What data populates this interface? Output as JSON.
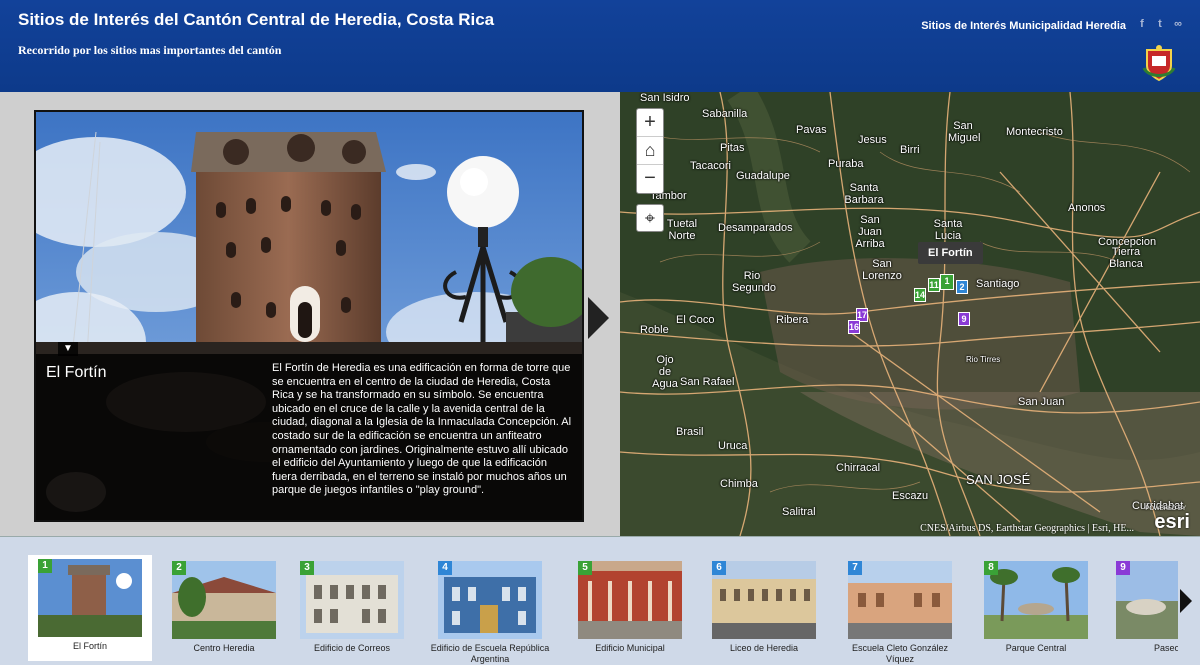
{
  "header": {
    "title": "Sitios de Interés del Cantón Central de Heredia, Costa Rica",
    "subtitle": "Recorrido por los sitios mas importantes del cantón",
    "link": "Sitios de Interés Municipalidad Heredia",
    "social_icons": [
      "facebook-icon",
      "twitter-icon",
      "link-icon"
    ]
  },
  "feature": {
    "title": "El Fortín",
    "description": "El Fortín de Heredia es una edificación en forma de torre que se encuentra en el centro de la ciudad de Heredia, Costa Rica y se ha transformado en su símbolo. Se encuentra ubicado en el cruce de la calle y la avenida central de la ciudad, diagonal a la Iglesia de la Inmaculada Concepción. Al costado sur de la edificación se encuentra un anfiteatro ornamentado con jardines. Originalmente estuvo allí ubicado el edificio del Ayuntamiento y luego de que la edificación fuera derribada, en el terreno se instaló por muchos años un parque de juegos infantiles o \"play ground\"."
  },
  "map": {
    "tooltip": "El Fortín",
    "zoom_in": "+",
    "zoom_out": "−",
    "home": "⌂",
    "locate": "⌖",
    "attribution": "CNES/Airbus DS, Earthstar Geographics | Esri, HE...",
    "powered": "POWERED BY",
    "logo": "esri",
    "labels": [
      "San Isidro",
      "Sabanilla",
      "Pavas",
      "Jesus",
      "Birri",
      "San Miguel",
      "Montecristo",
      "Pitas",
      "Tacacori",
      "Puraba",
      "Guadalupe",
      "Tambor",
      "Santa Barbara",
      "San Juan Arriba",
      "Santa Lucia",
      "Tuetal Norte",
      "Desamparados",
      "Anonos",
      "Concepcion",
      "Tierra Blanca",
      "Rio Segundo",
      "San Lorenzo",
      "Santiago",
      "El Coco",
      "Roble",
      "Ribera",
      "Ojo de Agua",
      "San Rafael",
      "San Juan",
      "Brasil",
      "Uruca",
      "Chirracal",
      "Chimba",
      "Escazu",
      "SAN JOSÉ",
      "Salitral",
      "Curridabat",
      "Rio Tirres"
    ],
    "pins": [
      "14",
      "1",
      "11",
      "2",
      "17",
      "16",
      "9"
    ]
  },
  "carousel": {
    "items": [
      {
        "num": "1",
        "label": "El Fortín",
        "color": "#3aa236"
      },
      {
        "num": "2",
        "label": "Centro Heredia",
        "color": "#3aa236"
      },
      {
        "num": "3",
        "label": "Edificio de Correos",
        "color": "#3aa236"
      },
      {
        "num": "4",
        "label": "Edificio de Escuela República Argentina",
        "color": "#2f86d6"
      },
      {
        "num": "5",
        "label": "Edificio Municipal",
        "color": "#3aa236"
      },
      {
        "num": "6",
        "label": "Liceo de Heredia",
        "color": "#2f86d6"
      },
      {
        "num": "7",
        "label": "Escuela Cleto González Víquez",
        "color": "#2f86d6"
      },
      {
        "num": "8",
        "label": "Parque Central",
        "color": "#3aa236"
      },
      {
        "num": "9",
        "label": "Paseo de",
        "color": "#8a3ad6"
      }
    ]
  }
}
